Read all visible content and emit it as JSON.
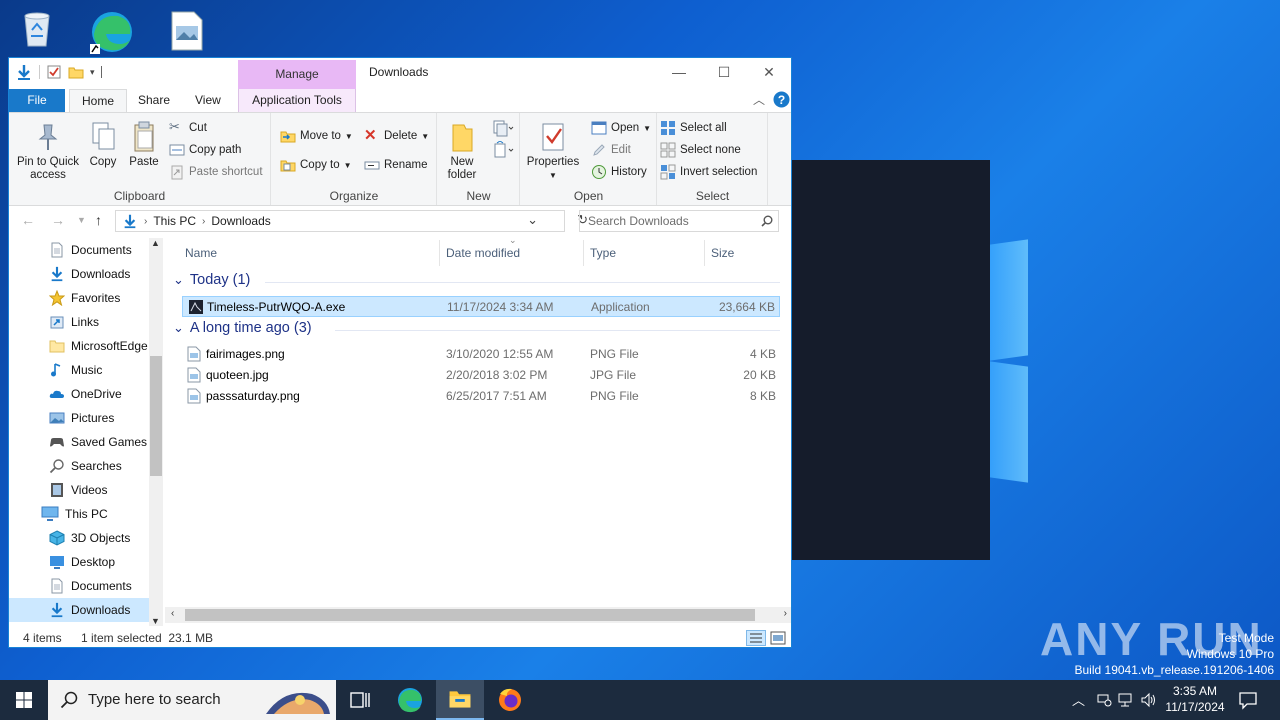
{
  "desktop": {
    "watermark": {
      "line1": "Test Mode",
      "line2": "Windows 10 Pro",
      "line3": "Build 19041.vb_release.191206-1406"
    },
    "brand": "ANY RUN"
  },
  "window": {
    "title": "Downloads",
    "contextual_tab_header": "Manage",
    "controls": {
      "minimize": "—",
      "maximize": "☐",
      "close": "✕"
    }
  },
  "tabs": {
    "file": "File",
    "home": "Home",
    "share": "Share",
    "view": "View",
    "app_tools": "Application Tools"
  },
  "ribbon": {
    "clipboard": {
      "label": "Clipboard",
      "pin": "Pin to Quick access",
      "copy": "Copy",
      "paste": "Paste",
      "cut": "Cut",
      "copy_path": "Copy path",
      "paste_shortcut": "Paste shortcut"
    },
    "organize": {
      "label": "Organize",
      "move_to": "Move to",
      "copy_to": "Copy to",
      "delete": "Delete",
      "rename": "Rename"
    },
    "new": {
      "label": "New",
      "new_folder": "New folder"
    },
    "open": {
      "label": "Open",
      "properties": "Properties",
      "open": "Open",
      "edit": "Edit",
      "history": "History"
    },
    "select": {
      "label": "Select",
      "select_all": "Select all",
      "select_none": "Select none",
      "invert": "Invert selection"
    }
  },
  "address": {
    "crumbs": [
      "This PC",
      "Downloads"
    ],
    "search_placeholder": "Search Downloads"
  },
  "nav": [
    {
      "label": "Documents",
      "icon": "document-icon",
      "indent": 1
    },
    {
      "label": "Downloads",
      "icon": "download-arrow-icon",
      "indent": 1
    },
    {
      "label": "Favorites",
      "icon": "star-icon",
      "indent": 1
    },
    {
      "label": "Links",
      "icon": "link-icon",
      "indent": 1
    },
    {
      "label": "MicrosoftEdge",
      "icon": "folder-icon",
      "indent": 1
    },
    {
      "label": "Music",
      "icon": "music-icon",
      "indent": 1
    },
    {
      "label": "OneDrive",
      "icon": "cloud-icon",
      "indent": 1
    },
    {
      "label": "Pictures",
      "icon": "pictures-icon",
      "indent": 1
    },
    {
      "label": "Saved Games",
      "icon": "games-icon",
      "indent": 1
    },
    {
      "label": "Searches",
      "icon": "search-icon",
      "indent": 1
    },
    {
      "label": "Videos",
      "icon": "video-icon",
      "indent": 1
    },
    {
      "label": "This PC",
      "icon": "computer-icon",
      "indent": 0
    },
    {
      "label": "3D Objects",
      "icon": "cube-icon",
      "indent": 1
    },
    {
      "label": "Desktop",
      "icon": "desktop-icon",
      "indent": 1
    },
    {
      "label": "Documents",
      "icon": "document-icon",
      "indent": 1
    },
    {
      "label": "Downloads",
      "icon": "download-arrow-icon",
      "indent": 1,
      "selected": true
    }
  ],
  "columns": {
    "name": "Name",
    "date": "Date modified",
    "type": "Type",
    "size": "Size"
  },
  "groups": [
    {
      "title": "Today (1)",
      "files": [
        {
          "name": "Timeless-PutrWQO-A.exe",
          "date": "11/17/2024 3:34 AM",
          "type": "Application",
          "size": "23,664 KB",
          "selected": true
        }
      ]
    },
    {
      "title": "A long time ago (3)",
      "files": [
        {
          "name": "fairimages.png",
          "date": "3/10/2020 12:55 AM",
          "type": "PNG File",
          "size": "4 KB"
        },
        {
          "name": "quoteen.jpg",
          "date": "2/20/2018 3:02 PM",
          "type": "JPG File",
          "size": "20 KB"
        },
        {
          "name": "passsaturday.png",
          "date": "6/25/2017 7:51 AM",
          "type": "PNG File",
          "size": "8 KB"
        }
      ]
    }
  ],
  "status": {
    "count": "4 items",
    "selection": "1 item selected  23.1 MB"
  },
  "taskbar": {
    "search_placeholder": "Type here to search",
    "time": "3:35 AM",
    "date": "11/17/2024"
  },
  "colors": {
    "accent": "#1979ca",
    "selection": "#cce8ff",
    "group_header": "#1e3287",
    "taskbar": "#1c2b3e"
  }
}
